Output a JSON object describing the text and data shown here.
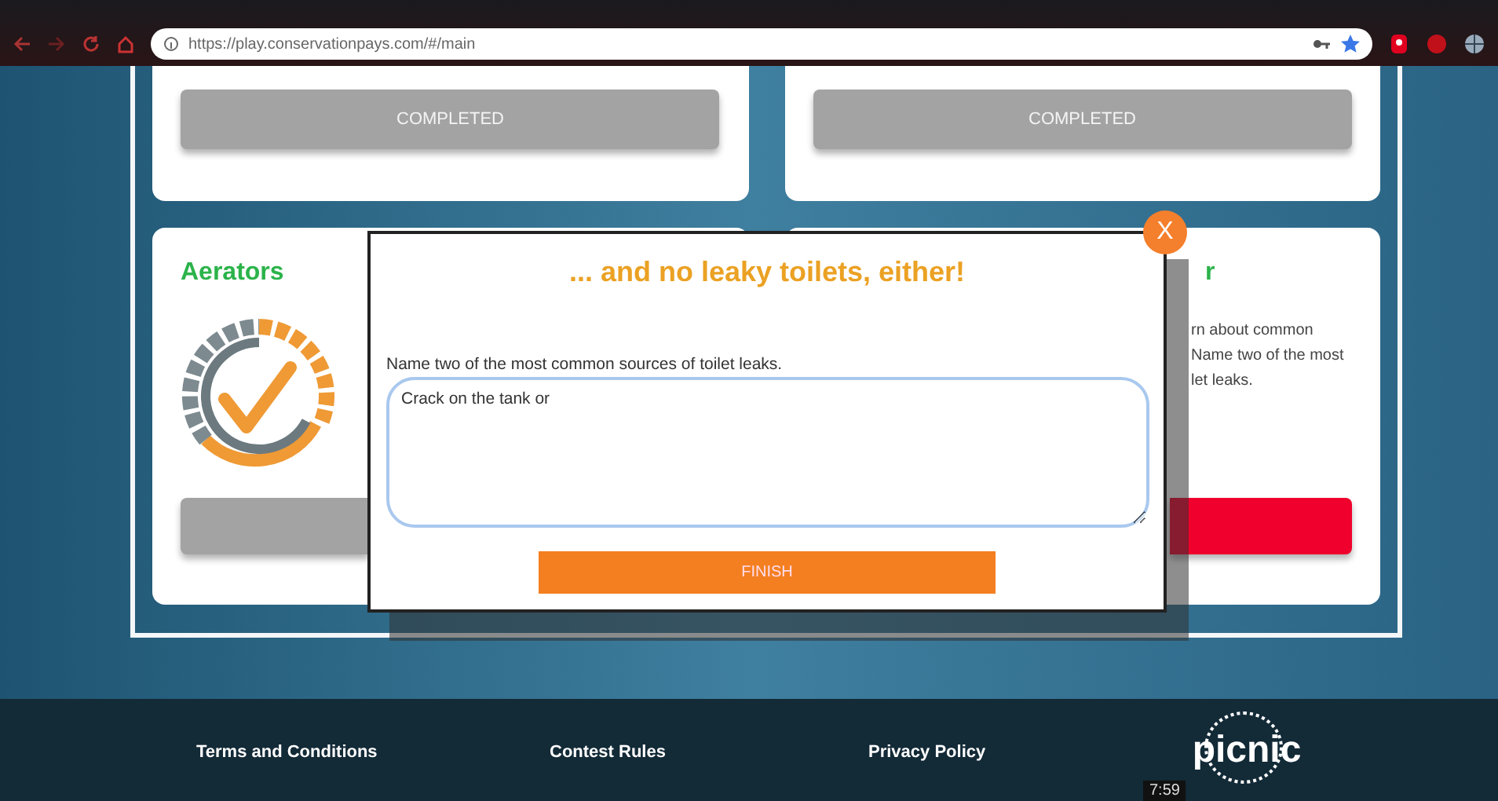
{
  "browser": {
    "url": "https://play.conservationpays.com/#/main"
  },
  "top_cards": [
    {
      "button": "COMPLETED"
    },
    {
      "button": "COMPLETED"
    }
  ],
  "left_card": {
    "title": "Aerators"
  },
  "right_card": {
    "title": "r",
    "description": "rn about common\nName two of the most\nlet leaks."
  },
  "modal": {
    "title": "... and no leaky toilets, either!",
    "close": "X",
    "question": "Name two of the most common sources of toilet leaks.",
    "answer": "Crack on the tank or",
    "button": "FINISH"
  },
  "footer": {
    "links": [
      "Terms and Conditions",
      "Contest Rules",
      "Privacy Policy"
    ],
    "logo": "picnic"
  },
  "video": {
    "time": "7:59"
  }
}
